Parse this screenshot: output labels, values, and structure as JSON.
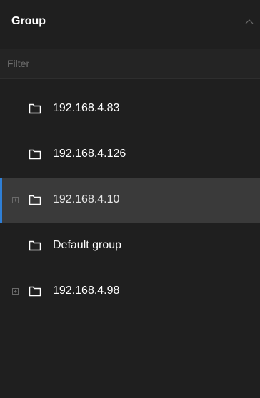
{
  "header": {
    "title": "Group",
    "collapse_icon": "chevron-up-icon"
  },
  "filter": {
    "placeholder": "Filter",
    "value": ""
  },
  "colors": {
    "background": "#1f1f1f",
    "selected_row": "#3a3a3a",
    "selection_accent": "#2f7fd6",
    "text": "#ffffff"
  },
  "tree": {
    "items": [
      {
        "label": "192.168.4.83",
        "icon": "folder-icon",
        "expandable": false,
        "selected": false
      },
      {
        "label": "192.168.4.126",
        "icon": "folder-icon",
        "expandable": false,
        "selected": false
      },
      {
        "label": "192.168.4.10",
        "icon": "folder-icon",
        "expandable": true,
        "selected": true
      },
      {
        "label": "Default group",
        "icon": "folder-icon",
        "expandable": false,
        "selected": false
      },
      {
        "label": "192.168.4.98",
        "icon": "folder-icon",
        "expandable": true,
        "selected": false
      }
    ]
  }
}
